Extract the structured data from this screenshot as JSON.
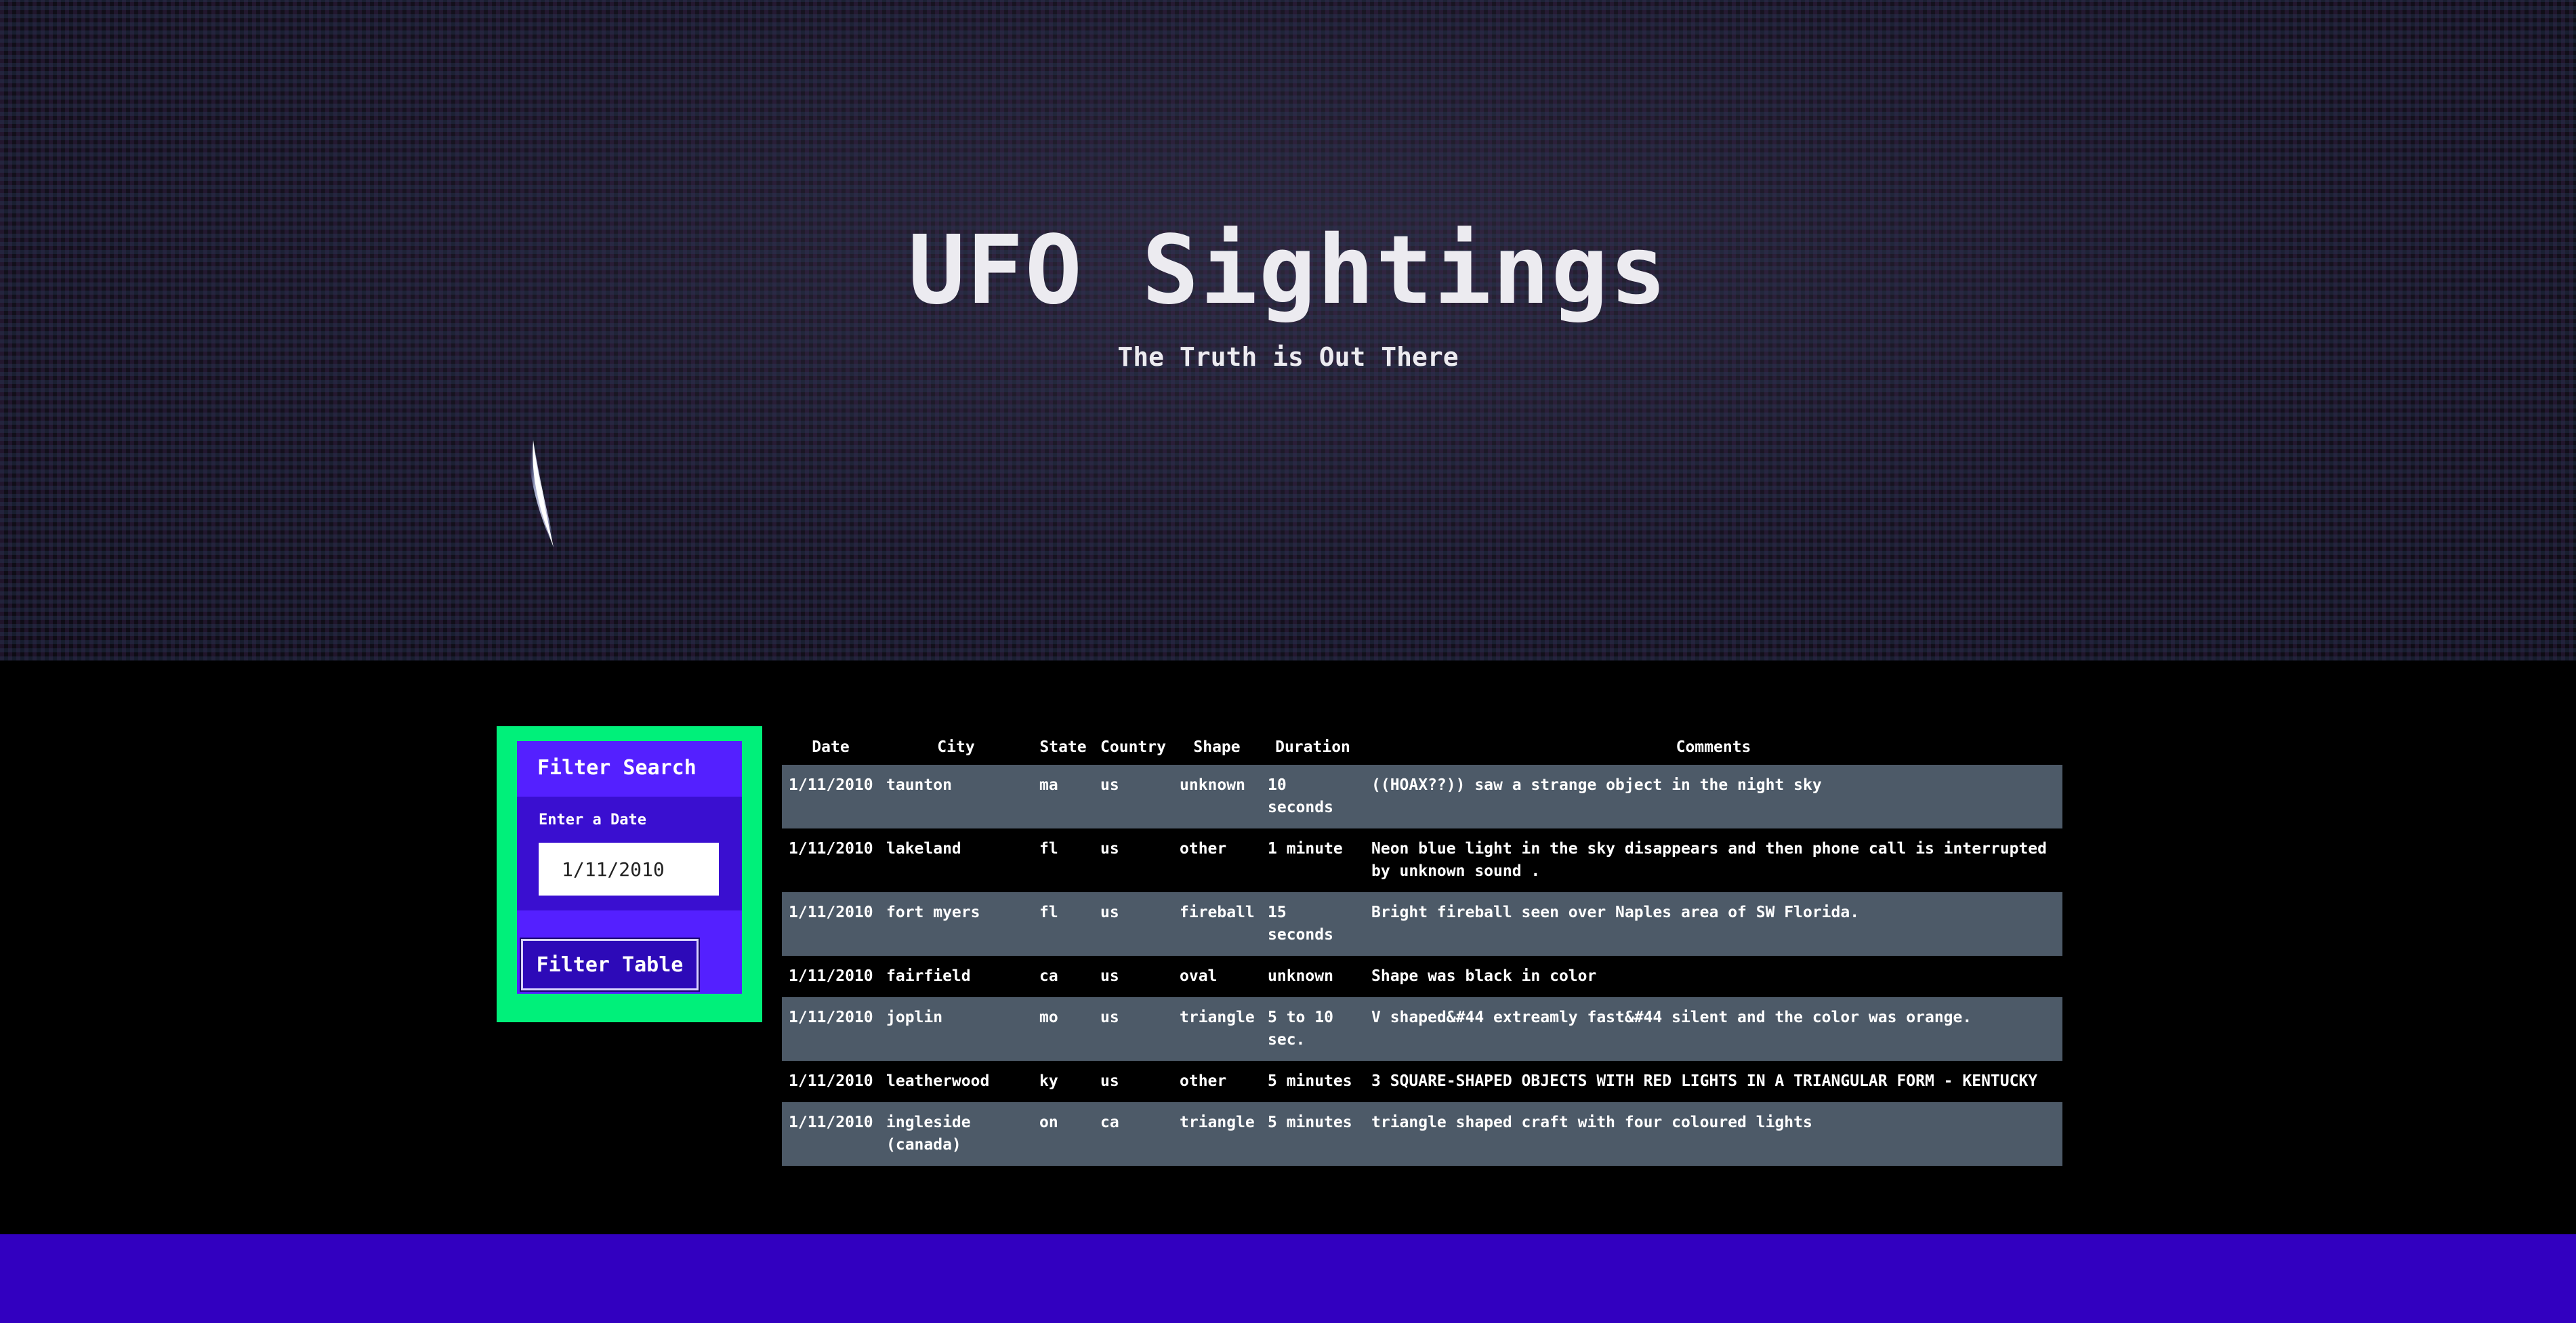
{
  "hero": {
    "title": "UFO Sightings",
    "subtitle": "The Truth is Out There"
  },
  "filter": {
    "heading": "Filter Search",
    "date_label": "Enter a Date",
    "date_value": "1/11/2010",
    "button_label": "Filter Table"
  },
  "table": {
    "headers": [
      "Date",
      "City",
      "State",
      "Country",
      "Shape",
      "Duration",
      "Comments"
    ],
    "rows": [
      {
        "date": "1/11/2010",
        "city": "taunton",
        "state": "ma",
        "country": "us",
        "shape": "unknown",
        "duration": "10 seconds",
        "comments": "((HOAX??)) saw a strange object in the night sky"
      },
      {
        "date": "1/11/2010",
        "city": "lakeland",
        "state": "fl",
        "country": "us",
        "shape": "other",
        "duration": "1 minute",
        "comments": "Neon blue light in the sky disappears and then phone call is interrupted by unknown sound ."
      },
      {
        "date": "1/11/2010",
        "city": "fort myers",
        "state": "fl",
        "country": "us",
        "shape": "fireball",
        "duration": "15 seconds",
        "comments": "Bright fireball seen over Naples area of SW Florida."
      },
      {
        "date": "1/11/2010",
        "city": "fairfield",
        "state": "ca",
        "country": "us",
        "shape": "oval",
        "duration": "unknown",
        "comments": "Shape was black in color"
      },
      {
        "date": "1/11/2010",
        "city": "joplin",
        "state": "mo",
        "country": "us",
        "shape": "triangle",
        "duration": "5 to 10 sec.",
        "comments": "V shaped&#44 extreamly fast&#44 silent and the color was orange."
      },
      {
        "date": "1/11/2010",
        "city": "leatherwood",
        "state": "ky",
        "country": "us",
        "shape": "other",
        "duration": "5 minutes",
        "comments": "3 SQUARE-SHAPED OBJECTS WITH RED LIGHTS IN A TRIANGULAR FORM - KENTUCKY"
      },
      {
        "date": "1/11/2010",
        "city": "ingleside (canada)",
        "state": "on",
        "country": "ca",
        "shape": "triangle",
        "duration": "5 minutes",
        "comments": "triangle shaped craft with four coloured lights"
      }
    ]
  },
  "colors": {
    "accent_green": "#00f07a",
    "accent_purple": "#4c19ff",
    "row_gray": "#4d5a68",
    "footer_purple": "#3200c0"
  }
}
